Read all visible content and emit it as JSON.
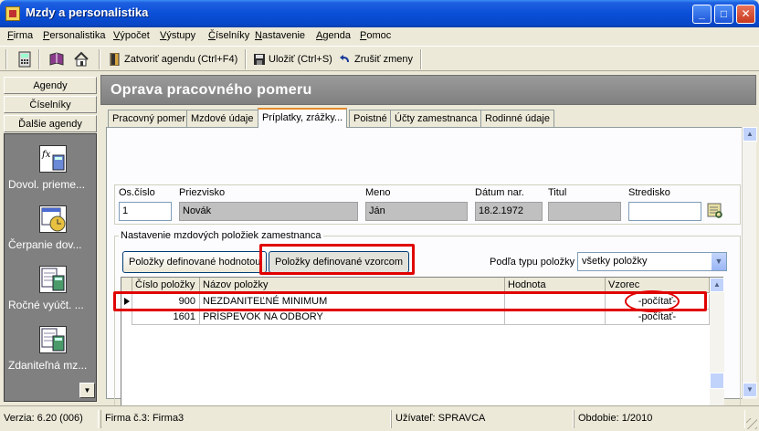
{
  "window": {
    "title": "Mzdy a personalistika",
    "min": "_",
    "max": "□",
    "close": "✕"
  },
  "menu": [
    "Firma",
    "Personalistika",
    "Výpočet",
    "Výstupy",
    "Číselníky",
    "Nastavenie",
    "Agenda",
    "Pomoc"
  ],
  "toolbar": {
    "close_agenda": "Zatvoriť agendu (Ctrl+F4)",
    "save": "Uložiť (Ctrl+S)",
    "cancel_changes": "Zrušiť zmeny"
  },
  "sidebar": {
    "tabs": [
      "Agendy",
      "Číselníky",
      "Ďalšie agendy"
    ],
    "items": [
      "Dovol. prieme...",
      "Čerpanie dov...",
      "Ročné vyúčt. ...",
      "Zdaniteľná mz..."
    ]
  },
  "page": {
    "title": "Oprava pracovného pomeru"
  },
  "tabs": [
    "Pracovný pomer",
    "Mzdové údaje",
    "Príplatky, zrážky...",
    "Poistné",
    "Účty zamestnanca",
    "Rodinné údaje"
  ],
  "employee": {
    "labels": {
      "os_cislo": "Os.číslo",
      "priezvisko": "Priezvisko",
      "meno": "Meno",
      "datum_nar": "Dátum nar.",
      "titul": "Titul",
      "stredisko": "Stredisko"
    },
    "values": {
      "os_cislo": "1",
      "priezvisko": "Novák",
      "meno": "Ján",
      "datum_nar": "18.2.1972",
      "titul": "",
      "stredisko": ""
    }
  },
  "group": {
    "title": "Nastavenie mzdových položiek zamestnanca",
    "btn_value": "Položky definované hodnotou",
    "btn_formula": "Položky definované vzorcom",
    "filter_label": "Podľa typu položky",
    "filter_value": "všetky položky"
  },
  "grid": {
    "columns": [
      "Číslo položky",
      "Názov položky",
      "Hodnota",
      "Vzorec"
    ],
    "rows": [
      {
        "cislo": "900",
        "nazov": "NEZDANITEĽNÉ MINIMUM",
        "hodnota": "",
        "vzorec": "-počítať-"
      },
      {
        "cislo": "1601",
        "nazov": "PRÍSPEVOK NA ODBORY",
        "hodnota": "",
        "vzorec": "-počítať-"
      }
    ]
  },
  "status": {
    "version": "Verzia: 6.20 (006)",
    "company": "Firma č.3: Firma3",
    "user": "Užívateľ: SPRAVCA",
    "period": "Obdobie: 1/2010"
  },
  "colors": {
    "highlight": "#e00000",
    "title_bar": "#0a4fd8",
    "header_gray": "#808080"
  }
}
